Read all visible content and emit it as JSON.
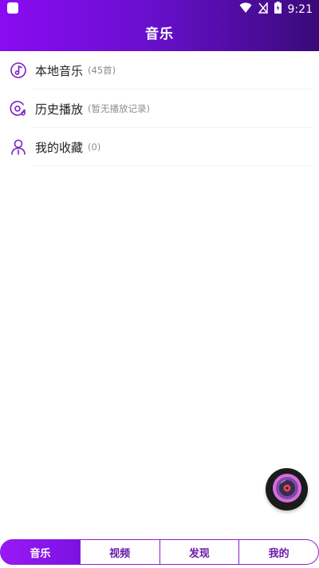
{
  "status_bar": {
    "time": "9:21"
  },
  "appbar": {
    "title": "音乐"
  },
  "list": [
    {
      "label": "本地音乐",
      "count": "(45首)",
      "icon": "music-note-icon"
    },
    {
      "label": "历史播放",
      "count": "(暂无播放记录)",
      "icon": "history-disc-icon"
    },
    {
      "label": "我的收藏",
      "count": "(0)",
      "icon": "user-collect-icon"
    }
  ],
  "player_fab": {
    "icon": "vinyl-record-icon"
  },
  "tabs": [
    {
      "label": "音乐",
      "active": true
    },
    {
      "label": "视频",
      "active": false
    },
    {
      "label": "发现",
      "active": false
    },
    {
      "label": "我的",
      "active": false
    }
  ],
  "colors": {
    "accent": "#8a0bf2",
    "accent_dark": "#3a0a7a",
    "tab_border": "#8a1bd8"
  }
}
